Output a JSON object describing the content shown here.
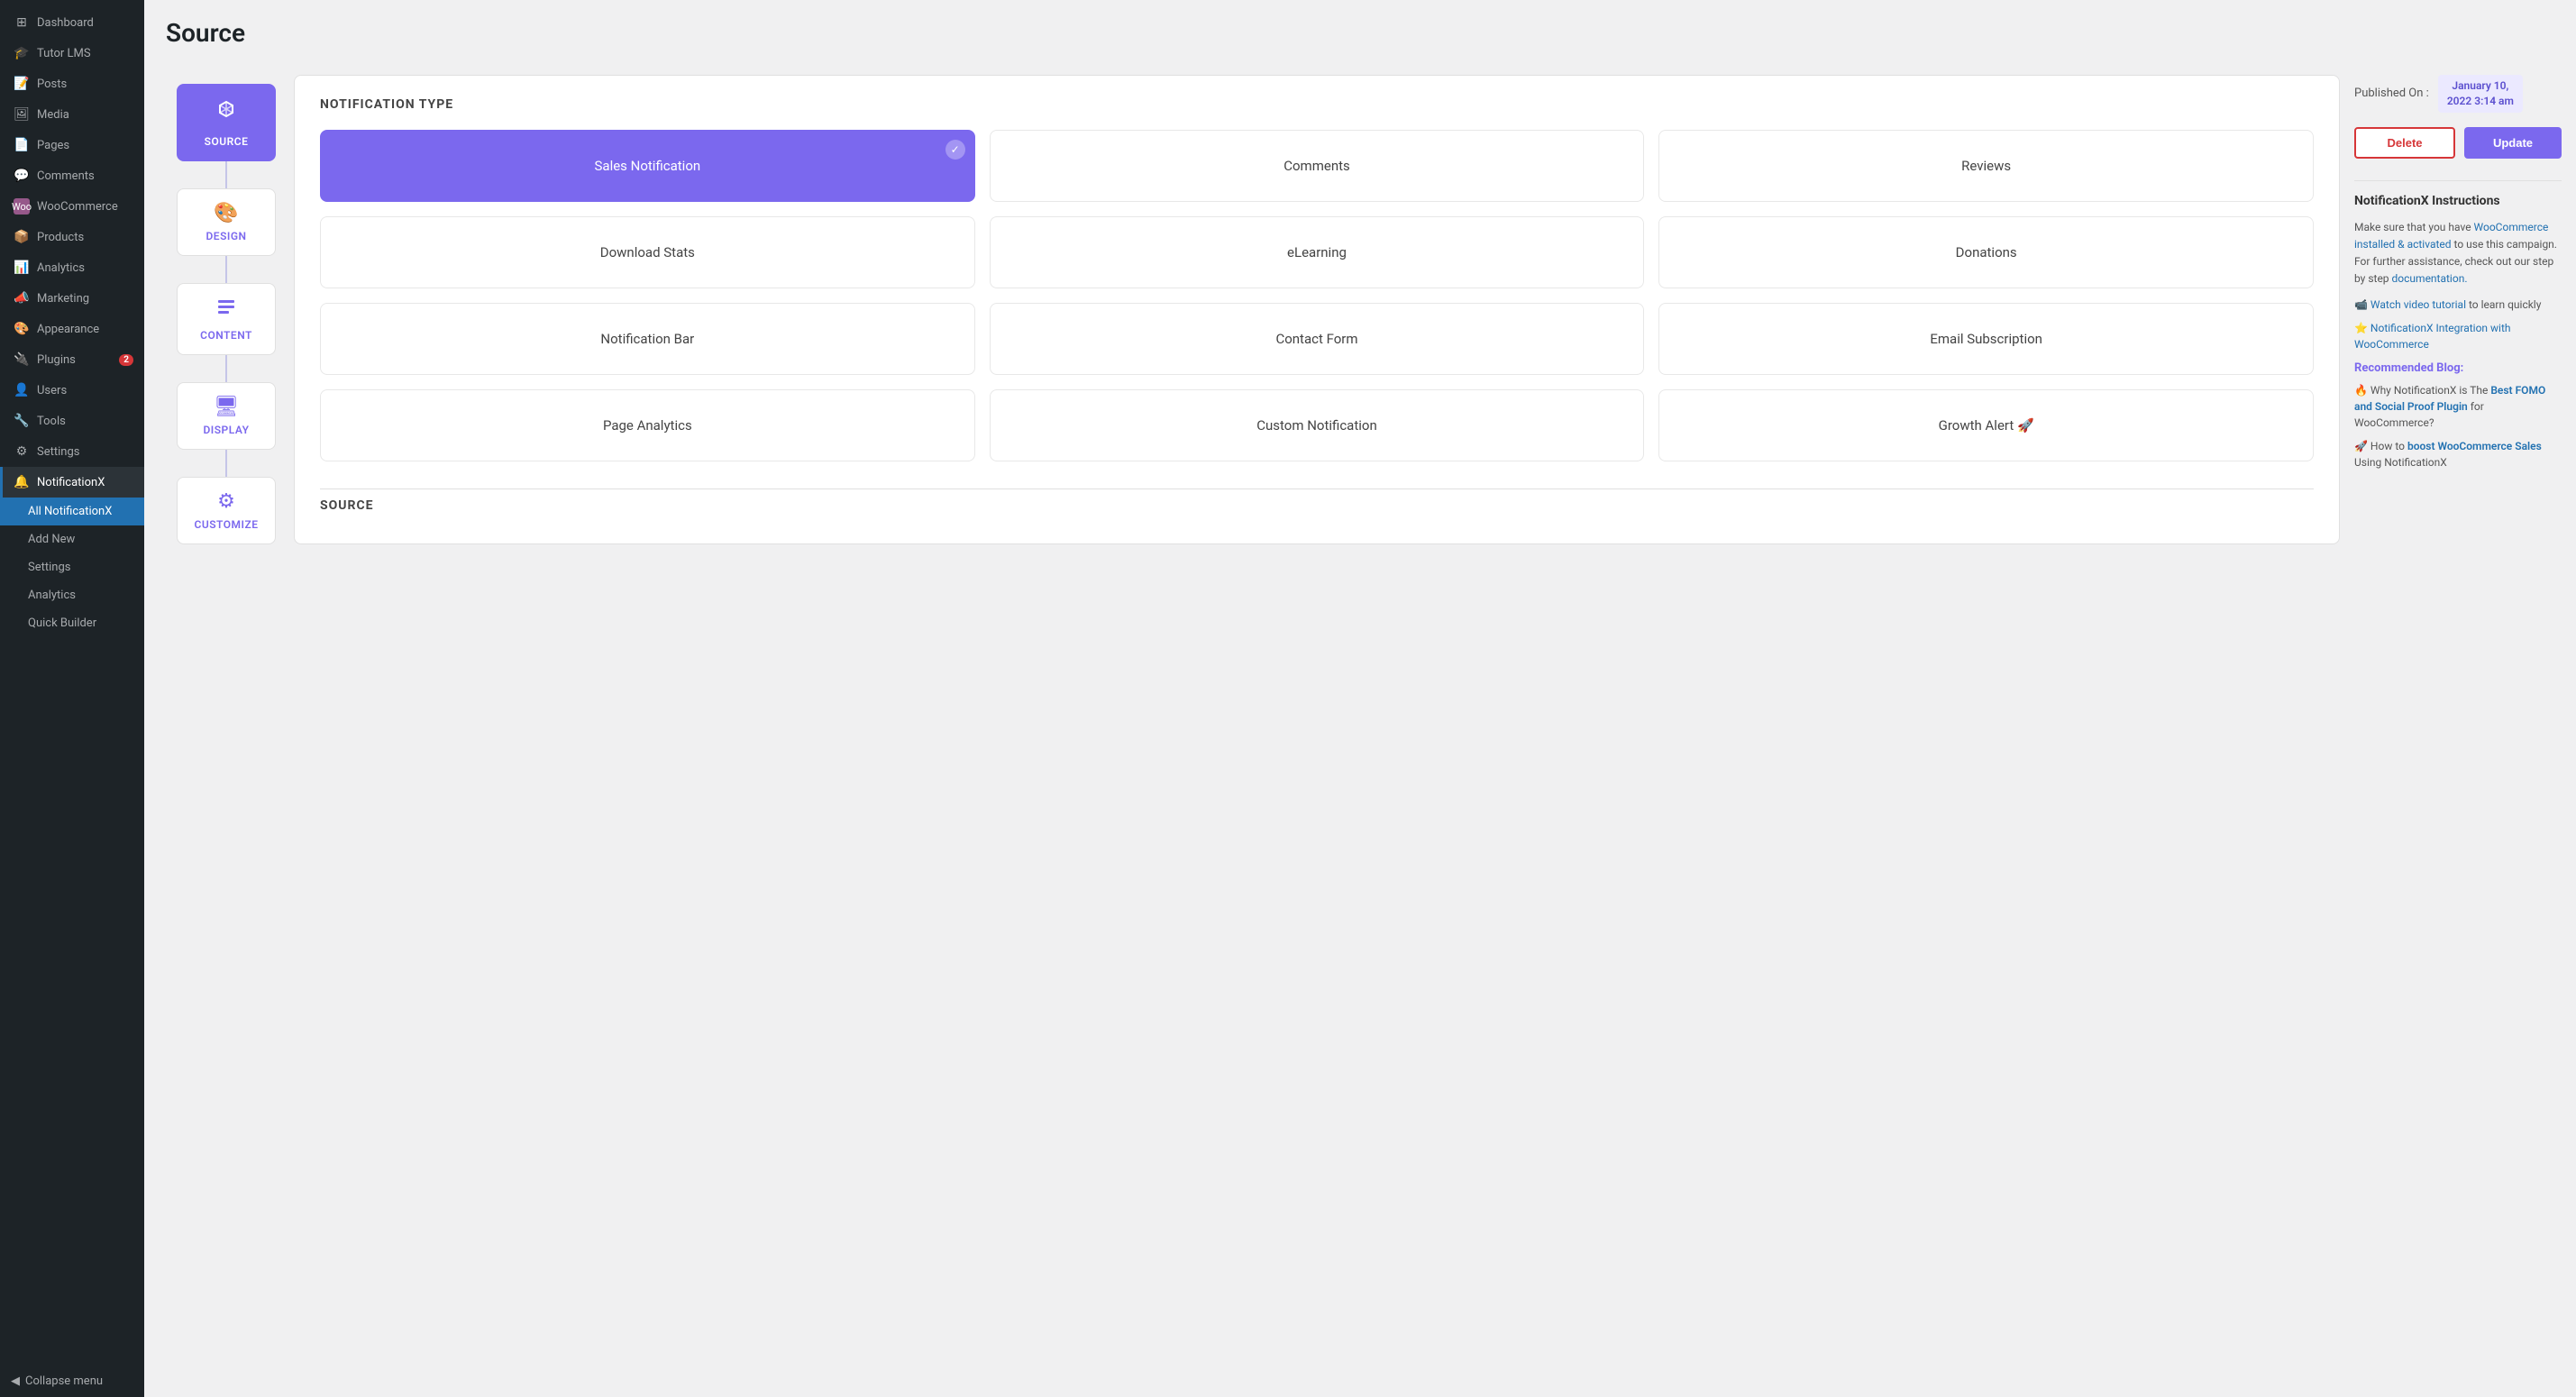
{
  "sidebar": {
    "items": [
      {
        "id": "dashboard",
        "label": "Dashboard",
        "icon": "⊞",
        "active": false
      },
      {
        "id": "tutor-lms",
        "label": "Tutor LMS",
        "icon": "🎓",
        "active": false
      },
      {
        "id": "posts",
        "label": "Posts",
        "icon": "📝",
        "active": false
      },
      {
        "id": "media",
        "label": "Media",
        "icon": "🖼",
        "active": false
      },
      {
        "id": "pages",
        "label": "Pages",
        "icon": "📄",
        "active": false
      },
      {
        "id": "comments",
        "label": "Comments",
        "icon": "💬",
        "active": false
      },
      {
        "id": "woocommerce",
        "label": "WooCommerce",
        "icon": "🛒",
        "active": false
      },
      {
        "id": "products",
        "label": "Products",
        "icon": "📦",
        "active": false
      },
      {
        "id": "analytics",
        "label": "Analytics",
        "icon": "📊",
        "active": false
      },
      {
        "id": "marketing",
        "label": "Marketing",
        "icon": "📣",
        "active": false
      },
      {
        "id": "appearance",
        "label": "Appearance",
        "icon": "🎨",
        "active": false
      },
      {
        "id": "plugins",
        "label": "Plugins",
        "icon": "🔌",
        "badge": "2",
        "active": false
      },
      {
        "id": "users",
        "label": "Users",
        "icon": "👤",
        "active": false
      },
      {
        "id": "tools",
        "label": "Tools",
        "icon": "🔧",
        "active": false
      },
      {
        "id": "settings",
        "label": "Settings",
        "icon": "⚙",
        "active": false
      },
      {
        "id": "notificationx",
        "label": "NotificationX",
        "icon": "🔔",
        "active": true
      }
    ],
    "sub_items": [
      {
        "id": "all-notificationx",
        "label": "All NotificationX",
        "active": true
      },
      {
        "id": "add-new",
        "label": "Add New",
        "active": false
      },
      {
        "id": "settings-sub",
        "label": "Settings",
        "active": false
      },
      {
        "id": "analytics-sub",
        "label": "Analytics",
        "active": false
      },
      {
        "id": "quick-builder",
        "label": "Quick Builder",
        "active": false
      }
    ],
    "collapse_label": "Collapse menu"
  },
  "page": {
    "title": "Source",
    "source_icon_label": "SOURCE"
  },
  "header": {
    "published_on_label": "Published On :",
    "published_date": "January 10,\n2022 3:14 am",
    "delete_label": "Delete",
    "update_label": "Update"
  },
  "steps": [
    {
      "id": "source",
      "label": "SOURCE",
      "icon": "⬡",
      "active": true
    },
    {
      "id": "design",
      "label": "DESIGN",
      "icon": "🎨",
      "active": false
    },
    {
      "id": "content",
      "label": "CONTENT",
      "icon": "☰",
      "active": false
    },
    {
      "id": "display",
      "label": "DISPLAY",
      "icon": "🖥",
      "active": false
    },
    {
      "id": "customize",
      "label": "CUSTOMIZE",
      "icon": "⚙",
      "active": false
    }
  ],
  "notification_type": {
    "section_title": "NOTIFICATION TYPE",
    "cards": [
      {
        "id": "sales-notification",
        "label": "Sales Notification",
        "selected": true
      },
      {
        "id": "comments",
        "label": "Comments",
        "selected": false
      },
      {
        "id": "reviews",
        "label": "Reviews",
        "selected": false
      },
      {
        "id": "download-stats",
        "label": "Download Stats",
        "selected": false
      },
      {
        "id": "elearning",
        "label": "eLearning",
        "selected": false
      },
      {
        "id": "donations",
        "label": "Donations",
        "selected": false
      },
      {
        "id": "notification-bar",
        "label": "Notification Bar",
        "selected": false
      },
      {
        "id": "contact-form",
        "label": "Contact Form",
        "selected": false
      },
      {
        "id": "email-subscription",
        "label": "Email Subscription",
        "selected": false
      },
      {
        "id": "page-analytics",
        "label": "Page Analytics",
        "selected": false
      },
      {
        "id": "custom-notification",
        "label": "Custom Notification",
        "selected": false
      },
      {
        "id": "growth-alert",
        "label": "Growth Alert 🚀",
        "selected": false
      }
    ]
  },
  "source_section": {
    "title": "SOURCE"
  },
  "instructions": {
    "title": "NotificationX Instructions",
    "paragraph": "Make sure that you have WooCommerce installed & activated to use this campaign. For further assistance, check out our step by step documentation.",
    "woo_link_text": "WooCommerce installed & activated",
    "doc_link_text": "documentation.",
    "watch_video": "📹 Watch video tutorial to learn quickly",
    "integration": "⭐ NotificationX Integration with WooCommerce",
    "recommended_blog_label": "Recommended Blog:",
    "blog1_pre": "🔥 Why NotificationX is The ",
    "blog1_link": "Best FOMO and Social Proof Plugin",
    "blog1_post": " for WooCommerce?",
    "blog2_pre": "🚀 How to ",
    "blog2_link": "boost WooCommerce Sales",
    "blog2_post": " Using NotificationX"
  }
}
